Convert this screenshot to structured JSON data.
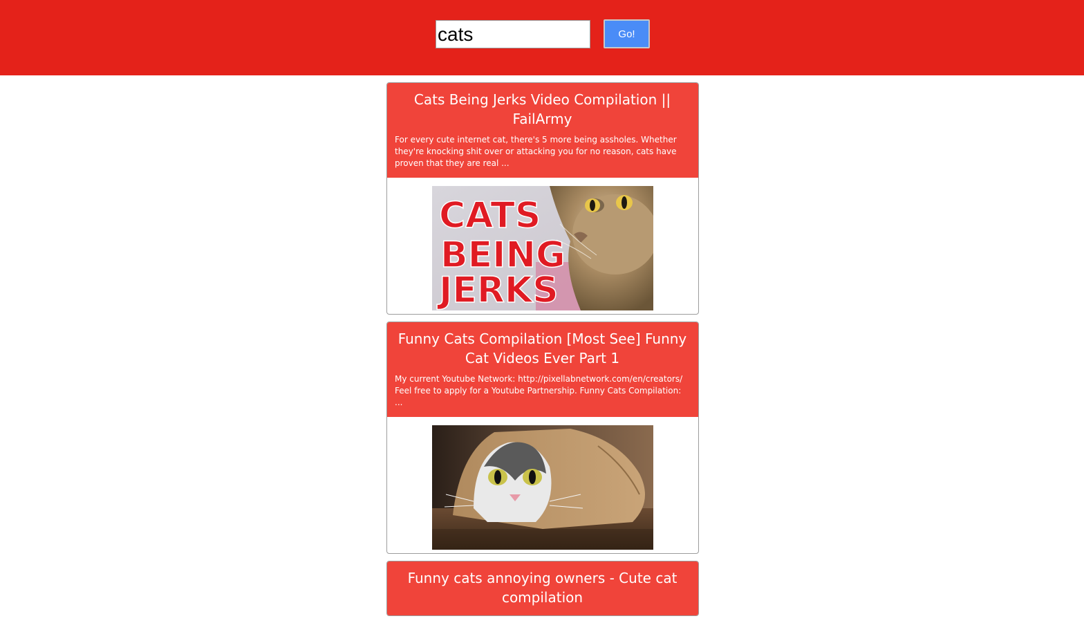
{
  "search": {
    "value": "cats",
    "button_label": "Go!"
  },
  "results": [
    {
      "title": "Cats Being Jerks Video Compilation || FailArmy",
      "description": "For every cute internet cat, there's 5 more being assholes. Whether they're knocking shit over or attacking you for no reason, cats have proven that they are real ...",
      "thumbnail_text": [
        "CATS",
        "BEING",
        "JERKS"
      ]
    },
    {
      "title": "Funny Cats Compilation [Most See] Funny Cat Videos Ever Part 1",
      "description": "My current Youtube Network: http://pixellabnetwork.com/en/creators/ Feel free to apply for a Youtube Partnership. Funny Cats Compilation: ..."
    },
    {
      "title": "Funny cats annoying owners - Cute cat compilation"
    }
  ],
  "colors": {
    "header_red": "#e4221a",
    "card_header_red": "#f0443a",
    "button_blue": "#4a8cf7"
  }
}
